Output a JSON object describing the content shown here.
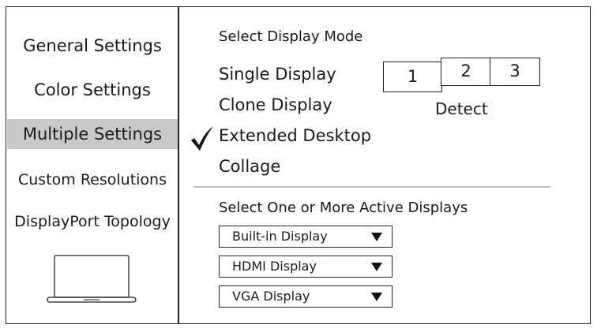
{
  "sidebar": {
    "items": [
      {
        "label": "General Settings"
      },
      {
        "label": "Color Settings"
      },
      {
        "label": "Multiple Settings"
      },
      {
        "label": "Custom Resolutions"
      },
      {
        "label": "DisplayPort Topology"
      }
    ],
    "active_index": 2,
    "device_icon": "laptop-icon"
  },
  "main": {
    "display_mode_heading": "Select Display Mode",
    "modes": [
      {
        "label": "Single Display",
        "selected": false
      },
      {
        "label": "Clone Display",
        "selected": false
      },
      {
        "label": "Extended Desktop",
        "selected": true
      },
      {
        "label": "Collage",
        "selected": false
      }
    ],
    "check_icon": "checkmark-icon",
    "displays": [
      "1",
      "2",
      "3"
    ],
    "detect_label": "Detect",
    "active_displays_heading": "Select One or More Active Displays",
    "dropdowns": [
      {
        "value": "Built-in Display"
      },
      {
        "value": "HDMI Display"
      },
      {
        "value": "VGA Display"
      }
    ]
  },
  "colors": {
    "active_item_bg": "#c9c9c9",
    "border": "#222222",
    "separator": "#bdbdbd"
  }
}
